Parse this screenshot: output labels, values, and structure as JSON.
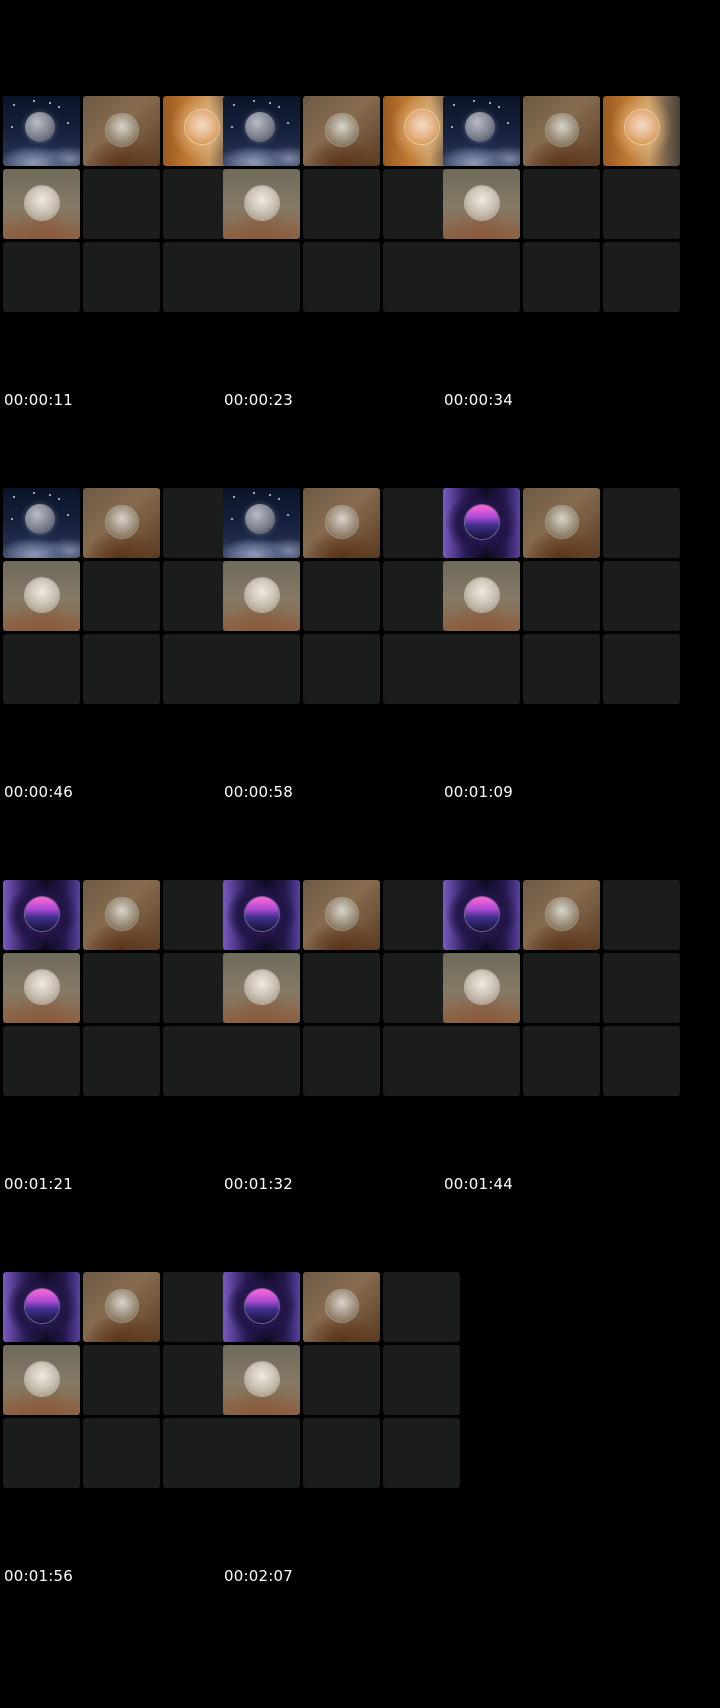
{
  "frames": [
    {
      "timestamp": "00:00:11",
      "tiles": [
        "moon",
        "bedroom",
        "blonde",
        "elder",
        "",
        "",
        "",
        "",
        ""
      ]
    },
    {
      "timestamp": "00:00:23",
      "tiles": [
        "moon",
        "bedroom",
        "blonde",
        "elder",
        "",
        "",
        "",
        "",
        ""
      ]
    },
    {
      "timestamp": "00:00:34",
      "tiles": [
        "moon",
        "bedroom",
        "blonde",
        "elder",
        "",
        "",
        "",
        "",
        ""
      ]
    },
    {
      "timestamp": "00:00:46",
      "tiles": [
        "moon",
        "bedroom",
        "",
        "elder",
        "",
        "",
        "",
        "",
        ""
      ]
    },
    {
      "timestamp": "00:00:58",
      "tiles": [
        "moon",
        "bedroom",
        "",
        "elder",
        "",
        "",
        "",
        "",
        ""
      ]
    },
    {
      "timestamp": "00:01:09",
      "tiles": [
        "neon",
        "bedroom",
        "",
        "elder",
        "",
        "",
        "",
        "",
        ""
      ]
    },
    {
      "timestamp": "00:01:21",
      "tiles": [
        "neon",
        "bedroom",
        "",
        "elder",
        "",
        "",
        "",
        "",
        ""
      ]
    },
    {
      "timestamp": "00:01:32",
      "tiles": [
        "neon",
        "bedroom",
        "",
        "elder",
        "",
        "",
        "",
        "",
        ""
      ]
    },
    {
      "timestamp": "00:01:44",
      "tiles": [
        "neon",
        "bedroom",
        "",
        "elder",
        "",
        "",
        "",
        "",
        ""
      ]
    },
    {
      "timestamp": "00:01:56",
      "tiles": [
        "neon",
        "bedroom",
        "",
        "elder",
        "",
        "",
        "",
        "",
        ""
      ]
    },
    {
      "timestamp": "00:02:07",
      "tiles": [
        "neon",
        "bedroom",
        "",
        "elder",
        "",
        "",
        "",
        "",
        ""
      ]
    }
  ],
  "tile_types": {
    "moon": {
      "name": "video-tile-moon",
      "icon": "moon-night-sky-image"
    },
    "bedroom": {
      "name": "video-tile-bedroom-selfie",
      "icon": "person-selfie-image"
    },
    "blonde": {
      "name": "video-tile-blonde-woman",
      "icon": "person-portrait-image"
    },
    "elder": {
      "name": "video-tile-older-person",
      "icon": "person-portrait-image"
    },
    "neon": {
      "name": "video-tile-purple-neon",
      "icon": "neon-graphic-image"
    }
  },
  "colors": {
    "background": "#000000",
    "empty_tile": "#1b1c1c",
    "timestamp_text": "#ffffff"
  }
}
